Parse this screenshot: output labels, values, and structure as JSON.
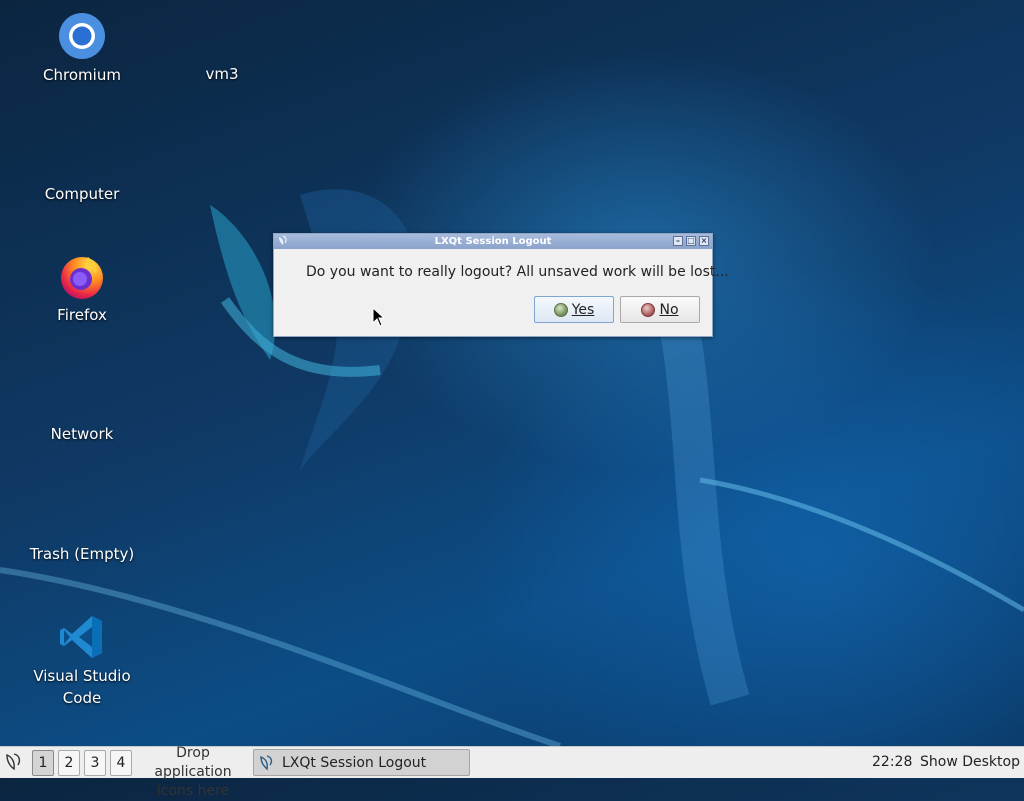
{
  "desktop": {
    "icons": [
      {
        "label": "Chromium",
        "icon": "chromium-icon"
      },
      {
        "label": "vm3",
        "icon": "none"
      },
      {
        "label": "Computer",
        "icon": "none"
      },
      {
        "label": "Firefox",
        "icon": "firefox-icon"
      },
      {
        "label": "Network",
        "icon": "none"
      },
      {
        "label": "Trash (Empty)",
        "icon": "none"
      },
      {
        "label": "Visual Studio\nCode",
        "icon": "vscode-icon"
      }
    ]
  },
  "dialog": {
    "title": "LXQt Session Logout",
    "message": "Do you want to really logout? All unsaved work will be lost...",
    "yes_label": "Yes",
    "no_label": "No"
  },
  "taskbar": {
    "workspaces": [
      "1",
      "2",
      "3",
      "4"
    ],
    "active_workspace": "1",
    "quicklaunch_text": "Drop application icons here",
    "task_label": "LXQt Session Logout",
    "clock": "22:28",
    "show_desktop": "Show Desktop"
  },
  "colors": {
    "accent": "#1e6bb8",
    "titlebar": "#8aa2cb",
    "taskbar": "#eeeeee"
  }
}
